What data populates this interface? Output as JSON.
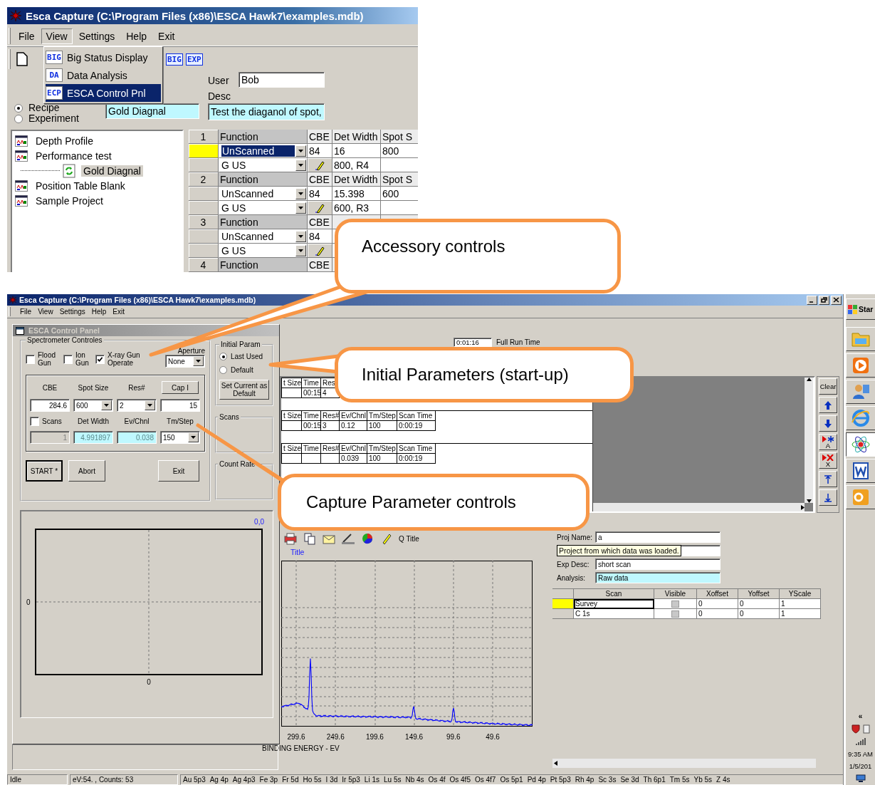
{
  "top_window": {
    "title": "Esca Capture (C:\\Program Files (x86)\\ESCA Hawk7\\examples.mdb)",
    "menu": [
      {
        "label": "File",
        "selected": false
      },
      {
        "label": "View",
        "selected": true
      },
      {
        "label": "Settings",
        "selected": false
      },
      {
        "label": "Help",
        "selected": false
      },
      {
        "label": "Exit",
        "selected": false
      }
    ],
    "view_menu": [
      {
        "badge": "BIG",
        "label": "Big Status Display",
        "selected": false
      },
      {
        "badge": "DA",
        "label": "Data Analysis",
        "selected": false
      },
      {
        "badge": "ECP",
        "label": "ESCA Control Pnl",
        "selected": true
      }
    ],
    "toolbar_badges": [
      "BIG",
      "EXP"
    ],
    "user": {
      "label": "User",
      "value": "Bob"
    },
    "desc": {
      "label": "Desc",
      "value": "Test the diaganol of spot,"
    },
    "mode": [
      {
        "label": "Recipe",
        "selected": true
      },
      {
        "label": "Experiment",
        "selected": false
      }
    ],
    "recipe_name": "Gold Diagnal",
    "tree": [
      {
        "label": "Depth Profile",
        "selected": false
      },
      {
        "label": "Performance test",
        "selected": false,
        "children": [
          {
            "label": "Gold Diagnal",
            "selected": true
          }
        ]
      },
      {
        "label": "Position Table Blank",
        "selected": false
      },
      {
        "label": "Sample Project",
        "selected": false
      }
    ],
    "grid": [
      {
        "kind": "header",
        "cells": [
          "1",
          "Function",
          "CBE",
          "Det Width",
          "Spot S"
        ]
      },
      {
        "kind": "function",
        "selected": true,
        "cells": [
          "UnScanned",
          "84",
          "16",
          "800"
        ]
      },
      {
        "kind": "setting",
        "cells": [
          "G US",
          "800, R4"
        ]
      },
      {
        "kind": "header",
        "cells": [
          "2",
          "Function",
          "CBE",
          "Det Width",
          "Spot S"
        ]
      },
      {
        "kind": "function",
        "selected": false,
        "cells": [
          "UnScanned",
          "84",
          "15.398",
          "600"
        ]
      },
      {
        "kind": "setting",
        "cells": [
          "G US",
          "600, R3"
        ]
      },
      {
        "kind": "header",
        "cells": [
          "3",
          "Function",
          "CBE"
        ]
      },
      {
        "kind": "function",
        "selected": false,
        "cells": [
          "UnScanned",
          "84"
        ]
      },
      {
        "kind": "setting",
        "cells": [
          "G US"
        ]
      },
      {
        "kind": "header",
        "cells": [
          "4",
          "Function",
          "CBE"
        ]
      }
    ]
  },
  "main_window": {
    "title": "Esca Capture (C:\\Program Files (x86)\\ESCA Hawk7\\examples.mdb)",
    "menu": [
      "File",
      "View",
      "Settings",
      "Help",
      "Exit"
    ],
    "run_time": {
      "value": "0:01:16",
      "label": "Full Run Time"
    },
    "step_tables": [
      {
        "columns": [
          {
            "header": "t Size"
          },
          {
            "header": "Time",
            "value": "00:15"
          },
          {
            "header": "Res",
            "value": "4"
          }
        ]
      },
      {
        "columns": [
          {
            "header": "t Size"
          },
          {
            "header": "Time",
            "value": "00:15"
          },
          {
            "header": "Res#",
            "value": "3"
          },
          {
            "header": "Ev/Chnl",
            "value": "0.12"
          },
          {
            "header": "Tm/Step",
            "value": "100"
          },
          {
            "header": "Scan Time",
            "value": "0:00:19"
          }
        ]
      },
      {
        "columns": [
          {
            "header": "t Size"
          },
          {
            "header": "Time"
          },
          {
            "header": "Res#"
          },
          {
            "header": "Ev/Chnl",
            "value": "0.039"
          },
          {
            "header": "Tm/Step",
            "value": "100"
          },
          {
            "header": "Scan Time",
            "value": "0:00:19"
          }
        ]
      }
    ],
    "side_buttons": [
      {
        "kind": "clear",
        "label": "Clear"
      },
      {
        "kind": "up"
      },
      {
        "kind": "down"
      },
      {
        "kind": "add-marker",
        "label": "A"
      },
      {
        "kind": "delete-marker",
        "label": "X"
      },
      {
        "kind": "top"
      },
      {
        "kind": "bottom"
      }
    ],
    "toolbar_label": "Q Title",
    "title_link": "Title",
    "spectrum": {
      "xticks": [
        "299.6",
        "249.6",
        "199.6",
        "149.6",
        "99.6",
        "49.6"
      ],
      "xlabel": "BINDING ENERGY - EV"
    },
    "project": {
      "fields": [
        {
          "label": "Proj Name:",
          "value": "a",
          "kind": "text"
        },
        {
          "label": "Exp Desc:",
          "value": "short scan",
          "kind": "text"
        },
        {
          "label": "Analysis:",
          "value": "Raw data",
          "kind": "readonly"
        }
      ],
      "tooltip": "Project from which data was loaded."
    },
    "scans": {
      "columns": [
        "Scan",
        "Visible",
        "Xoffset",
        "Yoffset",
        "YScale"
      ],
      "rows": [
        {
          "selected": true,
          "name": "Survey",
          "visible": false,
          "xoffset": "0",
          "yoffset": "0",
          "yscale": "1"
        },
        {
          "selected": false,
          "name": "C 1s",
          "visible": false,
          "xoffset": "0",
          "yoffset": "0",
          "yscale": "1"
        }
      ]
    },
    "status_bar": {
      "state": "Idle",
      "reading": "eV:54. , Counts: 53",
      "elements": [
        "Au 5p3",
        "Ag 4p",
        "Ag 4p3",
        "Fe 3p",
        "Fr 5d",
        "Ho 5s",
        "I 3d",
        "Ir 5p3",
        "Li 1s",
        "Lu 5s",
        "Nb 4s",
        "Os 4f",
        "Os 4f5",
        "Os 4f7",
        "Os 5p1",
        "Pd 4p",
        "Pt 5p3",
        "Rh 4p",
        "Sc 3s",
        "Se 3d",
        "Th 6p1",
        "Tm 5s",
        "Yb 5s",
        "Z 4s"
      ]
    }
  },
  "control_panel": {
    "title": "ESCA Control Panel",
    "spectrometer": {
      "title": "Spectrometer Controles",
      "toggles": [
        {
          "label": "Flood Gun",
          "checked": false
        },
        {
          "label": "Ion Gun",
          "checked": false
        },
        {
          "label": "X-ray Gun Operate",
          "checked": true
        }
      ],
      "aperture": {
        "label": "Aperture",
        "value": "None"
      }
    },
    "capture": {
      "labels_1": [
        "CBE",
        "Spot Size",
        "Res#"
      ],
      "cap_button": "Cap I",
      "inputs_1": [
        {
          "kind": "text",
          "value": "284.6"
        },
        {
          "kind": "dropdown",
          "value": "600"
        },
        {
          "kind": "dropdown",
          "value": "2"
        },
        {
          "kind": "text",
          "value": "15"
        }
      ],
      "scans": {
        "label": "Scans",
        "checked": false
      },
      "labels_2": [
        "Det Width",
        "Ev/Chnl",
        "Tm/Step"
      ],
      "inputs_2": [
        {
          "kind": "disabled",
          "value": "1"
        },
        {
          "kind": "readonly",
          "value": "4.991897"
        },
        {
          "kind": "readonly",
          "value": "0.038"
        },
        {
          "kind": "dropdown",
          "value": "150"
        }
      ]
    },
    "actions": [
      "START *",
      "Abort",
      "Exit"
    ],
    "initial_param": {
      "title": "Initial Param",
      "options": [
        {
          "label": "Last Used",
          "selected": true
        },
        {
          "label": "Default",
          "selected": false
        }
      ],
      "button": "Set Current as Default"
    },
    "groups": [
      "Scans",
      "Count Rate"
    ],
    "plot": {
      "corner": "0,0",
      "y_tick": "0",
      "x_tick": "0"
    }
  },
  "taskbar": {
    "start": "Star",
    "apps": [
      {
        "kind": "folder",
        "selected": false
      },
      {
        "kind": "media",
        "selected": false
      },
      {
        "kind": "person",
        "selected": false
      },
      {
        "kind": "browser",
        "selected": false
      },
      {
        "kind": "atom",
        "selected": true
      },
      {
        "kind": "document",
        "selected": false
      },
      {
        "kind": "mail",
        "selected": false
      }
    ],
    "tray_toggle": "«",
    "time": "9:35 AM",
    "date": "1/5/201"
  },
  "callouts": [
    {
      "text": "Accessory controls"
    },
    {
      "text": "Initial Parameters (start-up)"
    },
    {
      "text": "Capture Parameter controls"
    }
  ]
}
